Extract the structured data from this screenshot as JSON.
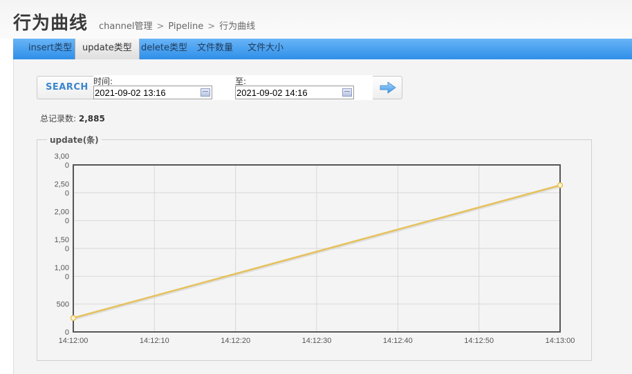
{
  "header": {
    "title": "行为曲线",
    "breadcrumb": [
      "channel管理",
      "Pipeline",
      "行为曲线"
    ],
    "breadcrumb_sep": ">"
  },
  "tabs": [
    {
      "label": "insert类型"
    },
    {
      "label": "update类型",
      "active": true
    },
    {
      "label": "delete类型"
    },
    {
      "label": "文件数量"
    },
    {
      "label": "文件大小"
    }
  ],
  "search": {
    "button_label": "SEARCH",
    "start_label": "时间:",
    "start_value": "2021-09-02 13:16",
    "end_label": "至:",
    "end_value": "2021-09-02 14:16",
    "go_icon": "arrow-right-icon"
  },
  "summary": {
    "label": "总记录数:",
    "value": "2,885"
  },
  "chart_title": "update(条)",
  "colors": {
    "tab_bar": "#3d9bf0",
    "series_line": "#e6c15a",
    "plot_bg": "#f4f4f4"
  },
  "chart_data": {
    "type": "line",
    "title": "update(条)",
    "x": [
      "14:12:00",
      "14:12:10",
      "14:12:20",
      "14:12:30",
      "14:12:40",
      "14:12:50",
      "14:13:00"
    ],
    "y_ticks": [
      [
        "0"
      ],
      [
        "500"
      ],
      [
        "1,00",
        "0"
      ],
      [
        "1,50",
        "0"
      ],
      [
        "2,00",
        "0"
      ],
      [
        "2,50",
        "0"
      ],
      [
        "3,00",
        "0"
      ]
    ],
    "ylim": [
      0,
      3000
    ],
    "grid": true,
    "series": [
      {
        "points": [
          {
            "x": "14:12:00",
            "y": 250
          },
          {
            "x": "14:13:00",
            "y": 2635
          }
        ]
      }
    ]
  }
}
